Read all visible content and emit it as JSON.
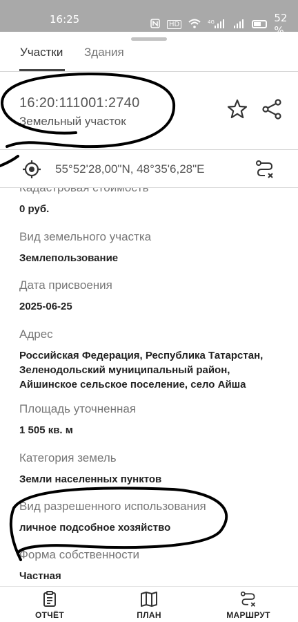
{
  "status_bar": {
    "time": "16:25",
    "battery": "52 %",
    "network": "4G",
    "hd": "HD"
  },
  "tabs": [
    {
      "label": "Участки",
      "active": true
    },
    {
      "label": "Здания",
      "active": false
    }
  ],
  "parcel": {
    "cadastral_number": "16:20:111001:2740",
    "type": "Земельный участок"
  },
  "coordinates": {
    "text": "55°52'28,00\"N, 48°35'6,28\"E"
  },
  "fields": [
    {
      "label": "Кадастровая стоимость",
      "value": "0 руб."
    },
    {
      "label": "Вид земельного участка",
      "value": "Землепользование"
    },
    {
      "label": "Дата присвоения",
      "value": "2025-06-25"
    },
    {
      "label": "Адрес",
      "value": "Российская Федерация, Республика Татарстан, Зеленодольский муниципальный район, Айшинское сельское поселение, село Айша"
    },
    {
      "label": "Площадь уточненная",
      "value": "1 505 кв. м"
    },
    {
      "label": "Категория земель",
      "value": "Земли населенных пунктов"
    },
    {
      "label": "Вид разрешенного использования",
      "value": "личное подсобное хозяйство"
    },
    {
      "label": "Форма собственности",
      "value": "Частная"
    }
  ],
  "bottom_nav": [
    {
      "label": "ОТЧЁТ",
      "icon": "report-icon"
    },
    {
      "label": "ПЛАН",
      "icon": "map-icon"
    },
    {
      "label": "МАРШРУТ",
      "icon": "route-icon"
    }
  ],
  "colors": {
    "status_bar": "#a9a9a9",
    "accent": "#444444",
    "scribble": "#000000"
  }
}
